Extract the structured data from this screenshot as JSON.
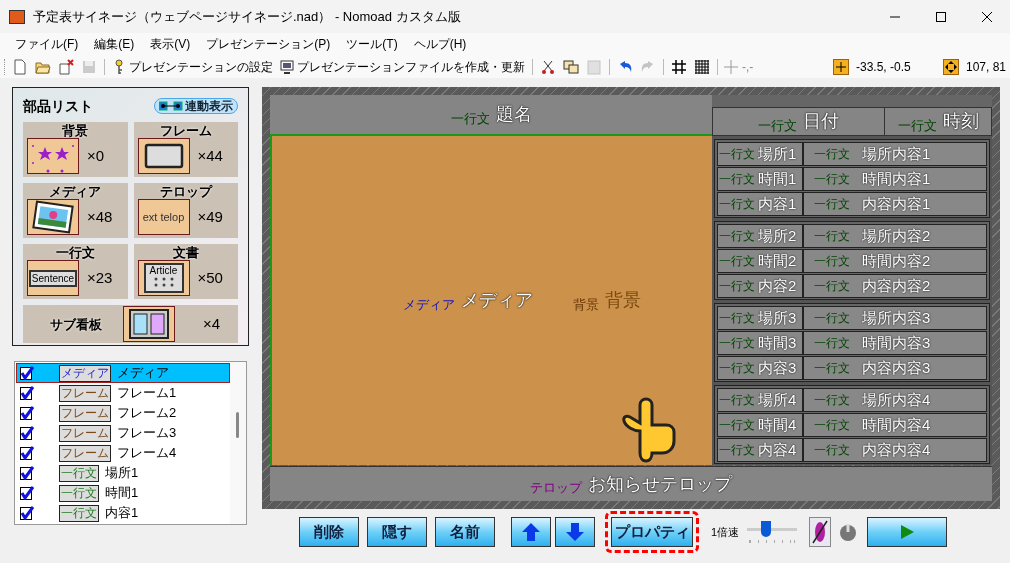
{
  "window": {
    "title": "予定表サイネージ（ウェブページサイネージ.nad） - Nomoad カスタム版"
  },
  "menu": [
    "ファイル(F)",
    "編集(E)",
    "表示(V)",
    "プレゼンテーション(P)",
    "ツール(T)",
    "ヘルプ(H)"
  ],
  "toolbar": {
    "file_tools": [
      {
        "disabled": false
      },
      {
        "disabled": false
      },
      {
        "disabled": false
      },
      {
        "disabled": true
      }
    ],
    "settings_button": "プレゼンテーションの設定",
    "build_button": "プレゼンテーションファイルを作成・更新",
    "edit_tools": [
      {
        "disabled": false
      },
      {
        "disabled": false
      },
      {
        "disabled": true
      },
      {
        "disabled": false
      },
      {
        "disabled": true
      },
      {
        "disabled": false
      },
      {
        "disabled": false
      }
    ],
    "cursor_readout": "-,-",
    "position_readout": "-33.5, -0.5",
    "size_readout": "107, 81"
  },
  "parts_panel": {
    "title": "部品リスト",
    "link_toggle": "連動表示",
    "parts": [
      {
        "kind": "background",
        "label": "背景",
        "count": "×0"
      },
      {
        "kind": "frame",
        "label": "フレーム",
        "count": "×44"
      },
      {
        "kind": "media",
        "label": "メディア",
        "count": "×48"
      },
      {
        "kind": "telop",
        "label": "テロップ",
        "count": "×49",
        "thumb_text": "ext telop"
      },
      {
        "kind": "sentence",
        "label": "一行文",
        "count": "×23",
        "thumb_text": "Sentence"
      },
      {
        "kind": "article",
        "label": "文書",
        "count": "×50",
        "thumb_text": "Article"
      },
      {
        "kind": "subboard",
        "label": "サブ看板",
        "count": "×4"
      }
    ]
  },
  "layer_list": [
    {
      "checked": true,
      "kind": "media",
      "tag": "メディア",
      "name": "メディア",
      "selected": true
    },
    {
      "checked": true,
      "kind": "frame",
      "tag": "フレーム",
      "name": "フレーム1",
      "selected": false
    },
    {
      "checked": true,
      "kind": "frame",
      "tag": "フレーム",
      "name": "フレーム2",
      "selected": false
    },
    {
      "checked": true,
      "kind": "frame",
      "tag": "フレーム",
      "name": "フレーム3",
      "selected": false
    },
    {
      "checked": true,
      "kind": "frame",
      "tag": "フレーム",
      "name": "フレーム4",
      "selected": false
    },
    {
      "checked": true,
      "kind": "sentence",
      "tag": "一行文",
      "name": "場所1",
      "selected": false
    },
    {
      "checked": true,
      "kind": "sentence",
      "tag": "一行文",
      "name": "時間1",
      "selected": false
    },
    {
      "checked": true,
      "kind": "sentence",
      "tag": "一行文",
      "name": "内容1",
      "selected": false
    }
  ],
  "canvas": {
    "title": {
      "kind": "sentence",
      "tag": "一行文",
      "text": "題名"
    },
    "date": {
      "kind": "sentence",
      "tag": "一行文",
      "text": "日付"
    },
    "time": {
      "kind": "sentence",
      "tag": "一行文",
      "text": "時刻"
    },
    "media": {
      "kind": "media",
      "tag": "メディア",
      "text": "メディア"
    },
    "background": {
      "kind": "background",
      "tag": "背景",
      "text": "背景"
    },
    "groups": [
      {
        "rows": [
          {
            "tag": "一行文",
            "label": "場所1",
            "content_tag": "一行文",
            "content": "場所内容1"
          },
          {
            "tag": "一行文",
            "label": "時間1",
            "content_tag": "一行文",
            "content": "時間内容1"
          },
          {
            "tag": "一行文",
            "label": "内容1",
            "content_tag": "一行文",
            "content": "内容内容1"
          }
        ]
      },
      {
        "rows": [
          {
            "tag": "一行文",
            "label": "場所2",
            "content_tag": "一行文",
            "content": "場所内容2"
          },
          {
            "tag": "一行文",
            "label": "時間2",
            "content_tag": "一行文",
            "content": "時間内容2"
          },
          {
            "tag": "一行文",
            "label": "内容2",
            "content_tag": "一行文",
            "content": "内容内容2"
          }
        ]
      },
      {
        "rows": [
          {
            "tag": "一行文",
            "label": "場所3",
            "content_tag": "一行文",
            "content": "場所内容3"
          },
          {
            "tag": "一行文",
            "label": "時間3",
            "content_tag": "一行文",
            "content": "時間内容3"
          },
          {
            "tag": "一行文",
            "label": "内容3",
            "content_tag": "一行文",
            "content": "内容内容3"
          }
        ]
      },
      {
        "rows": [
          {
            "tag": "一行文",
            "label": "場所4",
            "content_tag": "一行文",
            "content": "場所内容4"
          },
          {
            "tag": "一行文",
            "label": "時間4",
            "content_tag": "一行文",
            "content": "時間内容4"
          },
          {
            "tag": "一行文",
            "label": "内容4",
            "content_tag": "一行文",
            "content": "内容内容4"
          }
        ]
      }
    ],
    "telop": {
      "kind": "telop",
      "tag": "テロップ",
      "text": "お知らせテロップ"
    }
  },
  "bottom_bar": {
    "delete": "削除",
    "hide": "隠す",
    "rename": "名前",
    "properties": {
      "label": "プロパティ",
      "highlighted": true
    },
    "speed": "1倍速",
    "speed_slider": {
      "level": 0.35
    }
  }
}
